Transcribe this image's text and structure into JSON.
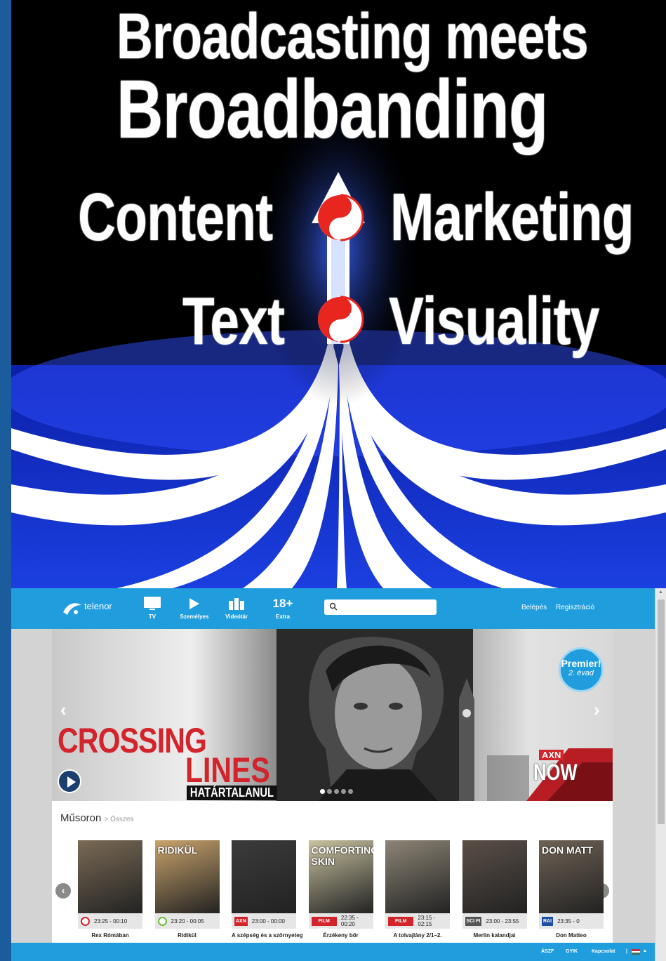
{
  "poster": {
    "headline_line1": "Broadcasting meets",
    "headline_line2": "Broadbanding",
    "row1_left": "Content",
    "row1_right": "Marketing",
    "row2_left": "Text",
    "row2_right": "Visuality",
    "colors": {
      "background": "#000000",
      "stripe_blue": "#1a3fd6",
      "symbol_red": "#e8261f"
    }
  },
  "site": {
    "brand": "telenor",
    "nav": [
      {
        "label": "TV",
        "icon": "tv-icon"
      },
      {
        "label": "Személyes",
        "icon": "play-icon"
      },
      {
        "label": "Videótár",
        "icon": "library-icon"
      },
      {
        "label": "Extra",
        "icon_text": "18+"
      }
    ],
    "search": {
      "placeholder": "",
      "value": ""
    },
    "login_label": "Belépés",
    "register_label": "Regisztráció",
    "hero": {
      "title_line1": "CROSSING",
      "title_line2": "LINES",
      "tagline": "HATÁRTALANUL",
      "premier_line1": "Premier!",
      "premier_line2": "2. évad",
      "channel_label": "AXN",
      "channel_sub": "NOW"
    },
    "section": {
      "title": "Műsoron",
      "breadcrumb": "> Összes"
    },
    "programs": [
      {
        "title": "Rex Rómában",
        "time": "23:25 - 00:10",
        "channel": "ring-red",
        "thumb_color": "#7a6a55"
      },
      {
        "title": "Ridikül",
        "time": "23:20 - 00:05",
        "channel": "ring-green",
        "thumb_color": "#c9a36b",
        "thumb_text": "RIDIKÜL"
      },
      {
        "title": "A szépség és a szörnyeteg",
        "time": "23:00 - 00:00",
        "channel": "AXN",
        "thumb_color": "#3b3b3b"
      },
      {
        "title": "Érzékeny bőr",
        "time": "22:35 - 00:20",
        "channel": "FILM BOX",
        "thumb_color": "#c8c2a0",
        "thumb_text": "COMFORTING SKIN"
      },
      {
        "title": "A tolvajlány 2/1–2.",
        "time": "23:15 - 02:15",
        "channel": "FILM BOX",
        "thumb_color": "#8d8576"
      },
      {
        "title": "Merlin kalandjai",
        "time": "23:00 - 23:55",
        "channel": "SCI FI",
        "thumb_color": "#5a4f47"
      },
      {
        "title": "Don Matteo",
        "time": "23:35 - 0",
        "channel": "RAI",
        "thumb_color": "#6f6255",
        "thumb_text": "DON MATT"
      }
    ],
    "footer": {
      "links": [
        "ÁSZF",
        "GYIK",
        "Kapcsolat"
      ],
      "separator": "|"
    }
  }
}
